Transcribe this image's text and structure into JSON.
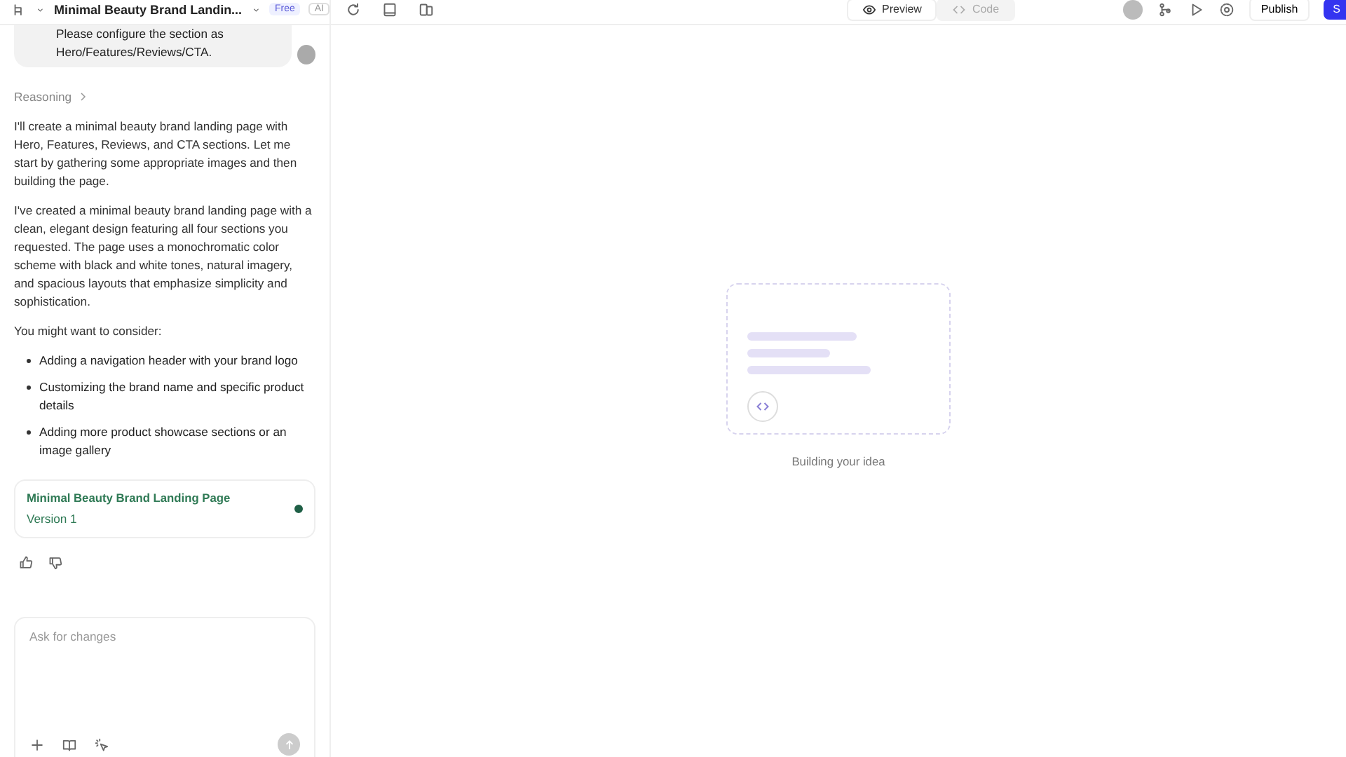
{
  "topbar": {
    "title": "Minimal Beauty Brand Landin...",
    "plan_badge": "Free",
    "ai_badge": "AI",
    "view_tabs": [
      {
        "label": "Preview",
        "selected": true
      },
      {
        "label": "Code",
        "selected": false
      }
    ],
    "publish": "Publish",
    "share": "S"
  },
  "chat": {
    "user_message": "Please configure the section as Hero/Features/Reviews/CTA.",
    "reasoning": "Reasoning",
    "paragraphs": [
      "I'll create a minimal beauty brand landing page with Hero, Features, Reviews, and CTA sections. Let me start by gathering some appropriate images and then building the page.",
      "I've created a minimal beauty brand landing page with a clean, elegant design featuring all four sections you requested. The page uses a monochromatic color scheme with black and white tones, natural imagery, and spacious layouts that emphasize simplicity and sophistication.",
      "You might want to consider:"
    ],
    "bullets": [
      "Adding a navigation header with your brand logo",
      "Customizing the brand name and specific product details",
      "Adding more product showcase sections or an image gallery"
    ],
    "version_card": {
      "title": "Minimal Beauty Brand Landing Page",
      "version": "Version 1",
      "color": "#1f5f46"
    },
    "input": {
      "placeholder": "Ask for changes"
    }
  },
  "preview": {
    "status": "Building your idea"
  }
}
